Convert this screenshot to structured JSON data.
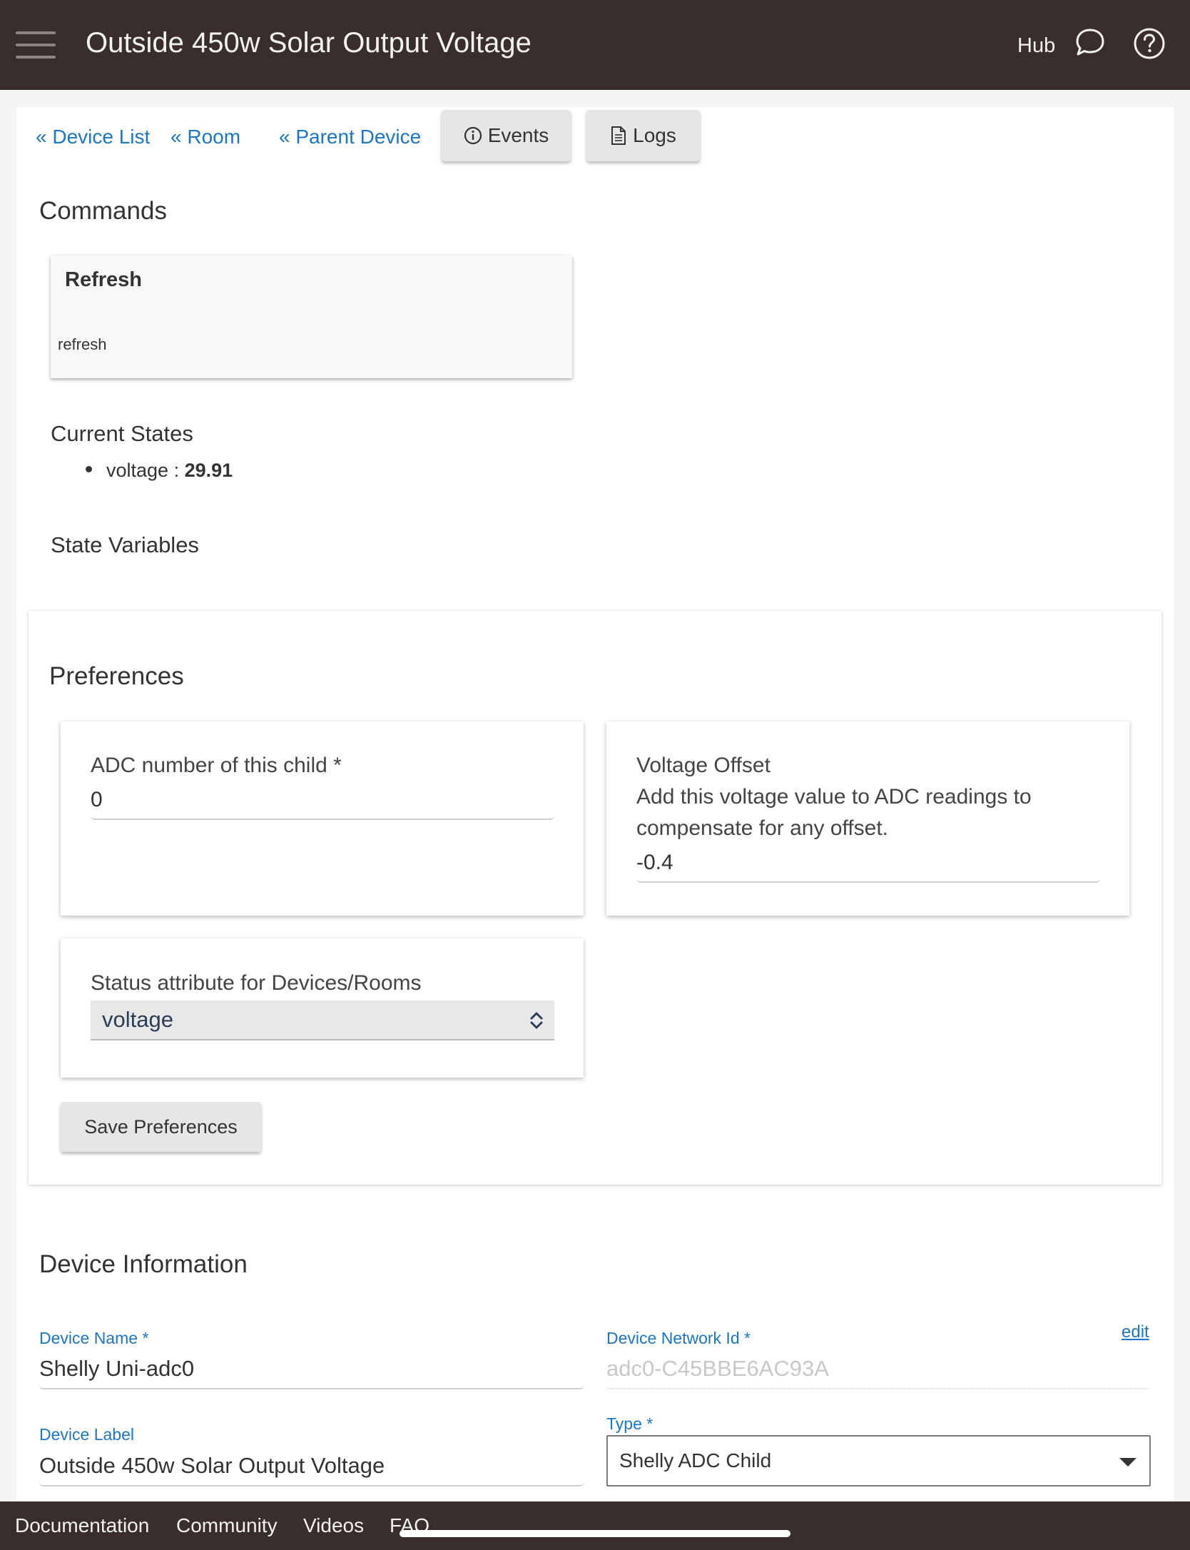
{
  "header": {
    "title": "Outside 450w Solar Output Voltage",
    "hub_label": "Hub"
  },
  "nav": {
    "device_list": "« Device List",
    "room": "« Room",
    "parent_device": "« Parent Device",
    "events": "Events",
    "logs": "Logs"
  },
  "commands": {
    "heading": "Commands",
    "items": [
      {
        "title": "Refresh",
        "name": "refresh"
      }
    ]
  },
  "current_states": {
    "heading": "Current States",
    "items": [
      {
        "name": "voltage",
        "separator": " : ",
        "value": "29.91"
      }
    ]
  },
  "state_variables": {
    "heading": "State Variables"
  },
  "preferences": {
    "heading": "Preferences",
    "adc_number": {
      "label": "ADC number of this child *",
      "value": "0"
    },
    "voltage_offset": {
      "label": "Voltage Offset",
      "description": "Add this voltage value to ADC readings to compensate for any offset.",
      "value": "-0.4"
    },
    "status_attribute": {
      "label": "Status attribute for Devices/Rooms",
      "selected": "voltage"
    },
    "save_label": "Save Preferences"
  },
  "device_information": {
    "heading": "Device Information",
    "device_name": {
      "label": "Device Name *",
      "value": "Shelly Uni-adc0"
    },
    "network_id": {
      "label": "Device Network Id *",
      "value": "adc0-C45BBE6AC93A",
      "edit": "edit"
    },
    "device_label": {
      "label": "Device Label",
      "value": "Outside 450w Solar Output Voltage"
    },
    "type": {
      "label": "Type *",
      "selected": "Shelly ADC Child"
    }
  },
  "footer": {
    "links": [
      "Documentation",
      "Community",
      "Videos",
      "FAQ"
    ]
  },
  "icons": {
    "menu": "hamburger-menu-icon",
    "chat": "chat-bubble-icon",
    "help": "question-circle-icon",
    "events": "info-circle-icon",
    "logs": "document-icon"
  },
  "colors": {
    "topbar": "#3a2e2c",
    "link": "#1e75c2",
    "button": "#e6e6e6"
  }
}
